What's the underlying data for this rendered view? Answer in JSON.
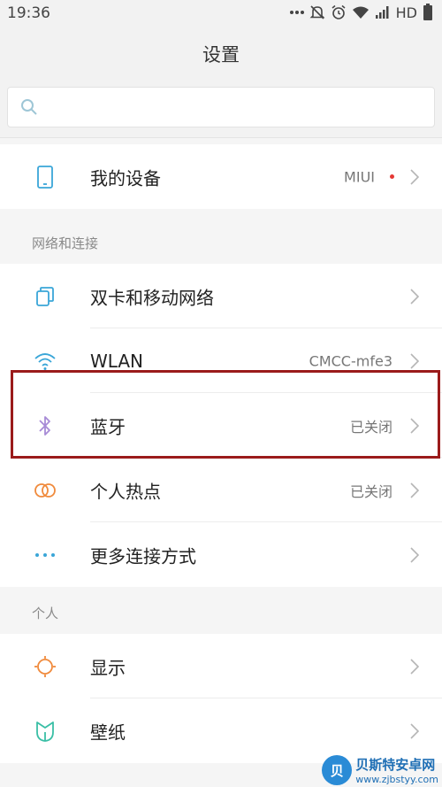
{
  "status_bar": {
    "time": "19:36",
    "network": "HD"
  },
  "header": {
    "title": "设置"
  },
  "search": {
    "placeholder": ""
  },
  "device_group": {
    "label": "我的设备",
    "value": "MIUI",
    "icon": "phone-icon"
  },
  "network_section": {
    "header": "网络和连接",
    "items": [
      {
        "label": "双卡和移动网络",
        "value": "",
        "icon": "sim-card-icon"
      },
      {
        "label": "WLAN",
        "value": "CMCC-mfe3",
        "icon": "wifi-icon"
      },
      {
        "label": "蓝牙",
        "value": "已关闭",
        "icon": "bluetooth-icon"
      },
      {
        "label": "个人热点",
        "value": "已关闭",
        "icon": "hotspot-icon"
      },
      {
        "label": "更多连接方式",
        "value": "",
        "icon": "more-icon"
      }
    ]
  },
  "personal_section": {
    "header": "个人",
    "items": [
      {
        "label": "显示",
        "value": "",
        "icon": "brightness-icon"
      },
      {
        "label": "壁纸",
        "value": "",
        "icon": "wallpaper-icon"
      }
    ]
  },
  "watermark": {
    "logo": "贝",
    "name": "贝斯特安卓网",
    "url": "www.zjbstyy.com"
  },
  "colors": {
    "highlight_border": "#9b1b1b",
    "notification_dot": "#e53935"
  }
}
